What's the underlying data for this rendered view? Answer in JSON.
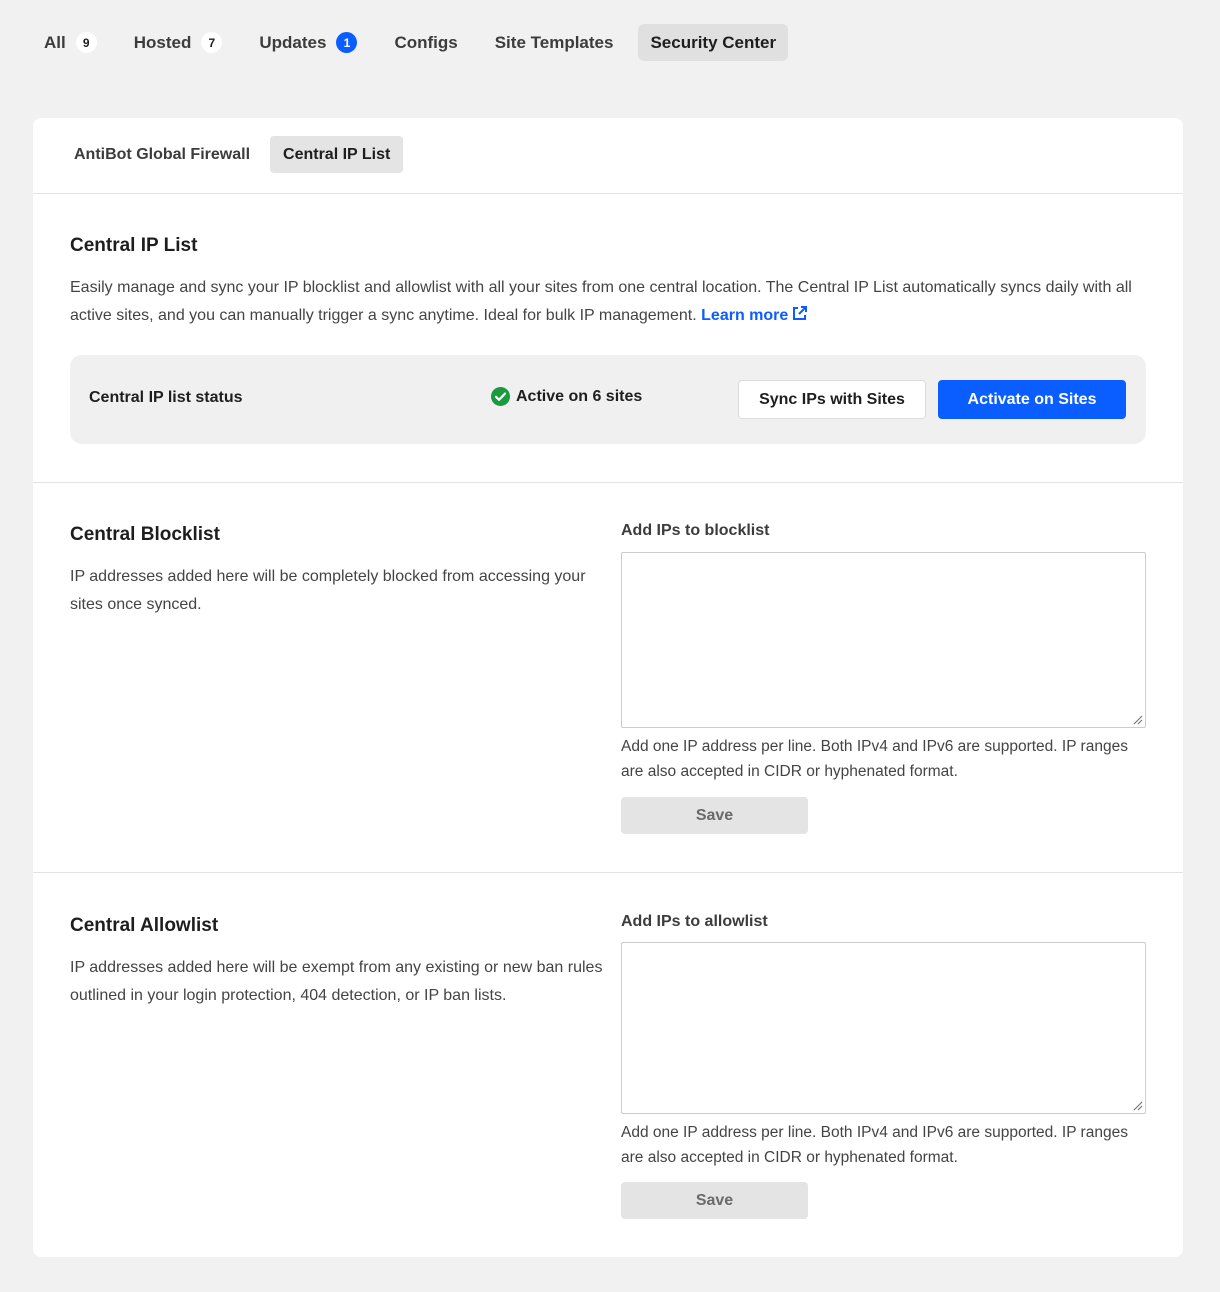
{
  "top_tabs": [
    {
      "label": "All",
      "badge": "9"
    },
    {
      "label": "Hosted",
      "badge": "7"
    },
    {
      "label": "Updates",
      "badge": "1"
    },
    {
      "label": "Configs"
    },
    {
      "label": "Site Templates"
    },
    {
      "label": "Security Center"
    }
  ],
  "sub_tabs": [
    {
      "label": "AntiBot Global Firewall"
    },
    {
      "label": "Central IP List"
    }
  ],
  "intro": {
    "title": "Central IP List",
    "description": "Easily manage and sync your IP blocklist and allowlist with all your sites from one central location. The Central IP List automatically syncs daily with all active sites, and you can manually trigger a sync anytime. Ideal for bulk IP management. ",
    "learn_more": "Learn more"
  },
  "status": {
    "label": "Central IP list status",
    "value": "Active on 6 sites",
    "sync_button": "Sync IPs with Sites",
    "activate_button": "Activate on Sites"
  },
  "blocklist": {
    "title": "Central Blocklist",
    "description": "IP addresses added here will be completely blocked from accessing your sites once synced.",
    "field_label": "Add IPs to blocklist",
    "value": "",
    "help": "Add one IP address per line. Both IPv4 and IPv6 are supported. IP ranges are also accepted in CIDR or hyphenated format.",
    "save_button": "Save"
  },
  "allowlist": {
    "title": "Central Allowlist",
    "description": "IP addresses added here will be exempt from any existing or new ban rules outlined in your login protection, 404 detection, or IP ban lists.",
    "field_label": "Add IPs to allowlist",
    "value": "",
    "help": "Add one IP address per line. Both IPv4 and IPv6 are supported. IP ranges are also accepted in CIDR or hyphenated format.",
    "save_button": "Save"
  },
  "colors": {
    "accent": "#0a5eff",
    "success": "#1a9a3e"
  },
  "icons": {
    "status": "check-circle-icon",
    "learn_more": "external-link-icon"
  }
}
